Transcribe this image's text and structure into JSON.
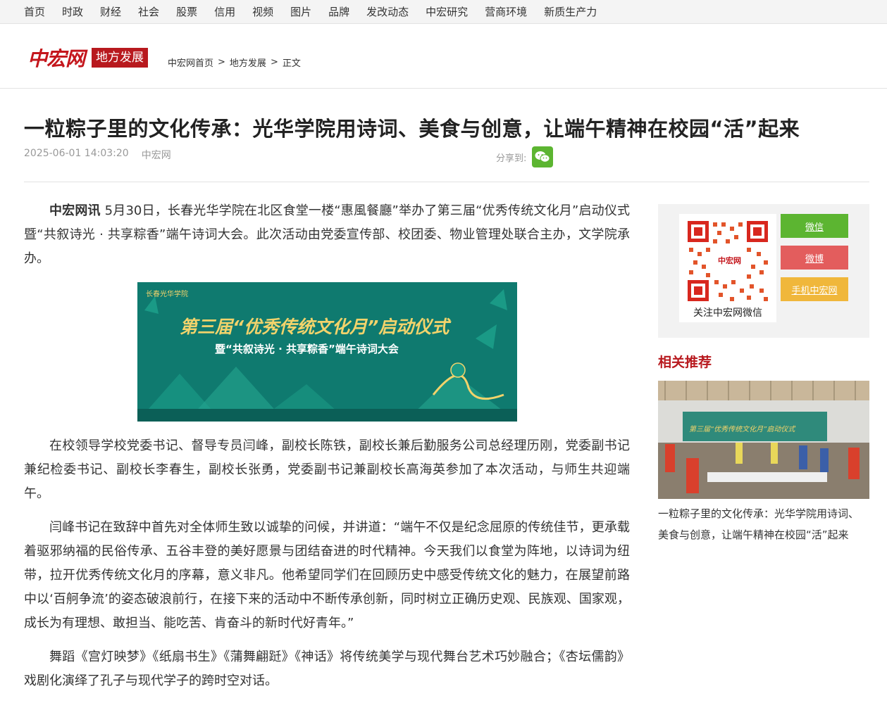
{
  "nav": [
    "首页",
    "时政",
    "财经",
    "社会",
    "股票",
    "信用",
    "视频",
    "图片",
    "品牌",
    "发改动态",
    "中宏研究",
    "营商环境",
    "新质生产力"
  ],
  "header": {
    "logo": "中宏网",
    "section_badge": "地方发展",
    "breadcrumb": [
      "中宏网首页",
      ">",
      "地方发展",
      ">",
      "正文"
    ]
  },
  "article": {
    "title": "一粒粽子里的文化传承：光华学院用诗词、美食与创意，让端午精神在校园“活”起来",
    "datetime": "2025-06-01 14:03:20",
    "source": "中宏网",
    "share_label": "分享到:",
    "lead": "中宏网讯",
    "p1": " 5月30日，长春光华学院在北区食堂一楼“惠風餐廳”举办了第三届“优秀传统文化月”启动仪式暨“共叙诗光 · 共享粽香”端午诗词大会。此次活动由党委宣传部、校团委、物业管理处联合主办，文学院承办。",
    "banner": {
      "school": "长春光华学院",
      "title": "第三届“优秀传统文化月”启动仪式",
      "subtitle": "暨“共叙诗光 · 共享粽香”端午诗词大会"
    },
    "p2": "在校领导学校党委书记、督导专员闫峰，副校长陈铁，副校长兼后勤服务公司总经理历刚，党委副书记兼纪检委书记、副校长李春生，副校长张勇，党委副书记兼副校长高海英参加了本次活动，与师生共迎端午。",
    "p3": "闫峰书记在致辞中首先对全体师生致以诚挚的问候，并讲道：“端午不仅是纪念屈原的传统佳节，更承载着驱邪纳福的民俗传承、五谷丰登的美好愿景与团结奋进的时代精神。今天我们以食堂为阵地，以诗词为纽带，拉开优秀传统文化月的序幕，意义非凡。他希望同学们在回顾历史中感受传统文化的魅力，在展望前路中以‘百舸争流’的姿态破浪前行，在接下来的活动中不断传承创新，同时树立正确历史观、民族观、国家观，成长为有理想、敢担当、能吃苦、肯奋斗的新时代好青年。”",
    "p4": "舞蹈《宫灯映梦》《纸扇书生》《蒲舞翩跹》《神话》将传统美学与现代舞台艺术巧妙融合；《杏坛儒韵》戏剧化演绎了孔子与现代学子的跨时空对话。"
  },
  "sidebar": {
    "qr_logo": "中宏网",
    "qr_caption": "关注中宏网微信",
    "buttons": [
      "微信",
      "微博",
      "手机中宏网"
    ],
    "related_title": "相关推荐",
    "related_item": "一粒粽子里的文化传承：光华学院用诗词、美食与创意，让端午精神在校园“活”起来",
    "related_banner": "第三届“优秀传统文化月”启动仪式"
  },
  "colors": {
    "brand_red": "#b8191e",
    "wechat_green": "#5cb531",
    "weibo_red": "#e35d5d",
    "mobile_yellow": "#f0b73b"
  }
}
